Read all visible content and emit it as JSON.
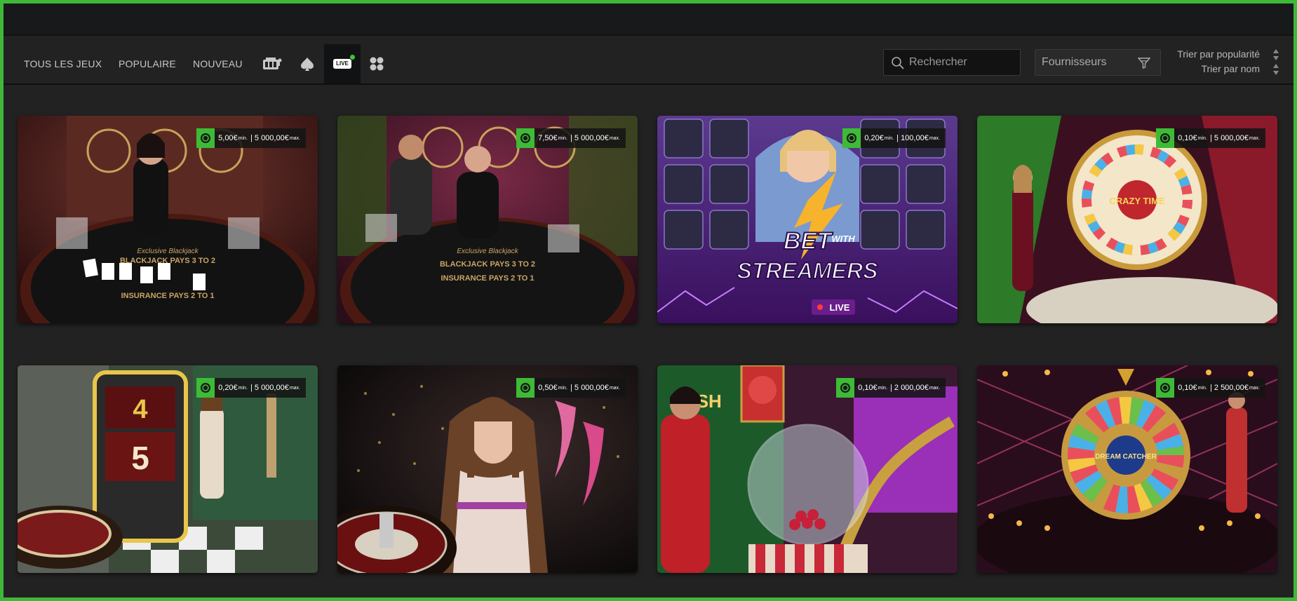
{
  "nav": {
    "tabs": [
      "TOUS LES JEUX",
      "POPULAIRE",
      "NOUVEAU"
    ],
    "icons": [
      "video-slot-icon",
      "spade-icon",
      "live-icon",
      "grid-icon"
    ],
    "live_label": "LIVE",
    "active_tab": "live"
  },
  "search": {
    "placeholder": "Rechercher"
  },
  "providers": {
    "label": "Fournisseurs"
  },
  "sort": {
    "popularity": "Trier par popularité",
    "name": "Trier par nom"
  },
  "colors": {
    "accent": "#3fb83a",
    "background": "#222222",
    "topbar": "#18191a"
  },
  "games": [
    {
      "min": "5,00€",
      "max": "5 000,00€",
      "min_tag": "min.",
      "max_tag": "max.",
      "art": "blackjack-1",
      "scene_text": [
        "Exclusive Blackjack",
        "BLACKJACK PAYS 3 TO 2",
        "INSURANCE PAYS 2 TO 1"
      ]
    },
    {
      "min": "7,50€",
      "max": "5 000,00€",
      "min_tag": "min.",
      "max_tag": "max.",
      "art": "blackjack-2",
      "scene_text": [
        "Exclusive Blackjack",
        "BLACKJACK PAYS 3 TO 2",
        "INSURANCE PAYS 2 TO 1"
      ]
    },
    {
      "min": "0,20€",
      "max": "100,00€",
      "min_tag": "min.",
      "max_tag": "max.",
      "art": "streamers",
      "scene_text": [
        "BET",
        "WITH",
        "STREAMERS",
        "LIVE"
      ]
    },
    {
      "min": "0,10€",
      "max": "5 000,00€",
      "min_tag": "min.",
      "max_tag": "max.",
      "art": "crazy-time",
      "scene_text": [
        "CRAZY TIME"
      ]
    },
    {
      "min": "0,20€",
      "max": "5 000,00€",
      "min_tag": "min.",
      "max_tag": "max.",
      "art": "lightning-roulette",
      "scene_text": [
        "4",
        "5"
      ]
    },
    {
      "min": "0,50€",
      "max": "5 000,00€",
      "min_tag": "min.",
      "max_tag": "max.",
      "art": "roulette",
      "scene_text": []
    },
    {
      "min": "0,10€",
      "max": "2 000,00€",
      "min_tag": "min.",
      "max_tag": "max.",
      "art": "cash-or-crash",
      "scene_text": [
        "CASH"
      ]
    },
    {
      "min": "0,10€",
      "max": "2 500,00€",
      "min_tag": "min.",
      "max_tag": "max.",
      "art": "dream-catcher",
      "scene_text": [
        "DREAM CATCHER"
      ]
    }
  ]
}
